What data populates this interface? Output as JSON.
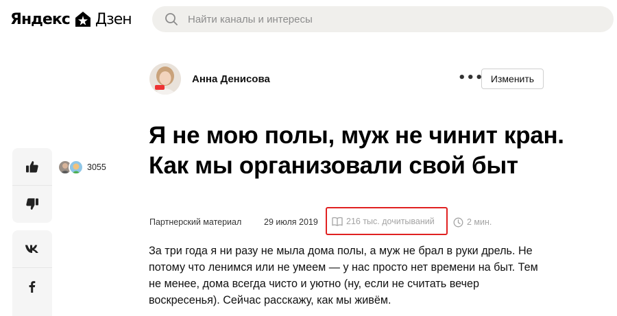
{
  "header": {
    "logo_left": "Яндекс",
    "logo_right": "Дзен",
    "search_placeholder": "Найти каналы и интересы"
  },
  "author": {
    "name": "Анна Денисова",
    "more_label": "•••",
    "edit_label": "Изменить"
  },
  "article": {
    "title": "Я не мою полы, муж не чинит кран. Как мы организовали свой быт",
    "meta": {
      "type": "Партнерский материал",
      "date": "29 июля 2019",
      "reads": "216 тыс. дочитываний",
      "read_time": "2 мин."
    },
    "body": "За три года я ни разу не мыла дома полы, а муж не брал в руки дрель. Не потому что ленимся или не умеем — у нас просто нет времени на быт. Тем не менее, дома всегда чисто и уютно (ну, если не считать вечер воскресенья). Сейчас расскажу, как мы живём."
  },
  "sidebar": {
    "like_count": "3055",
    "icons": [
      "thumbs-up-icon",
      "thumbs-down-icon",
      "vk-icon",
      "facebook-icon"
    ]
  },
  "colors": {
    "highlight_border": "#e02020",
    "search_bg": "#f0efec",
    "panel_bg": "#f5f5f5",
    "muted_text": "#a3a3a3"
  }
}
